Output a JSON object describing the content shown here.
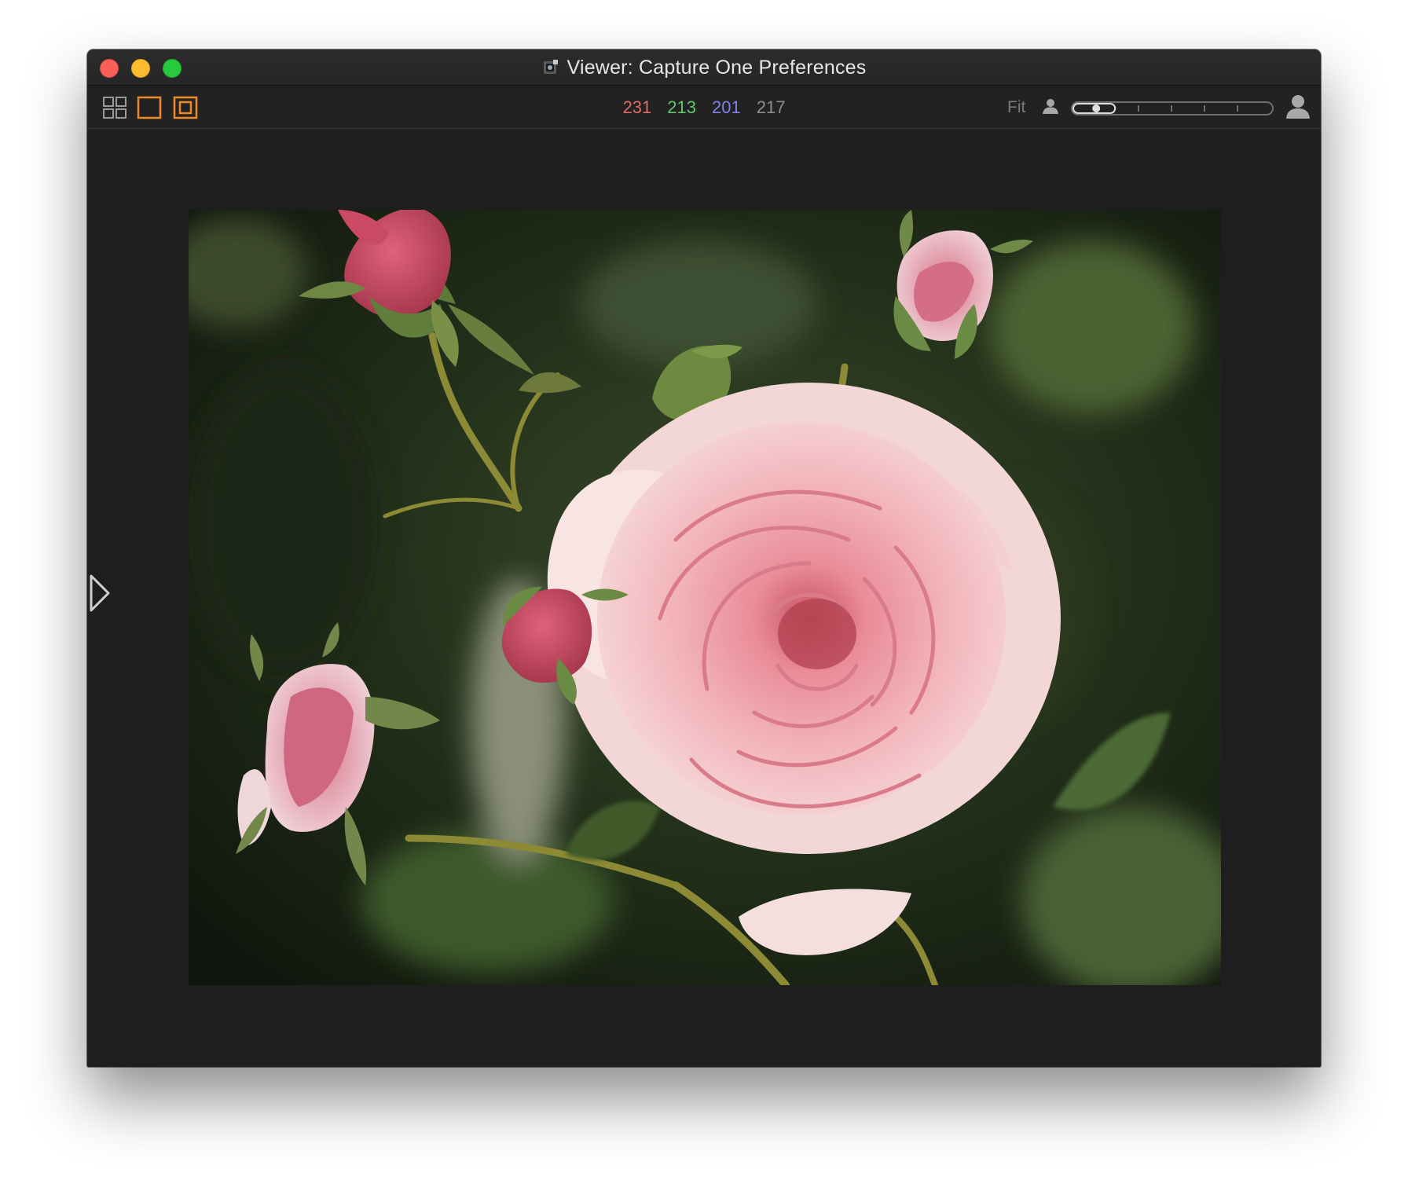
{
  "window": {
    "title": "Viewer: Capture One Preferences"
  },
  "toolbar": {
    "icons": [
      "grid-view-icon",
      "single-view-icon",
      "proof-margin-icon"
    ],
    "readout": {
      "r": "231",
      "g": "213",
      "b": "201",
      "l": "217"
    },
    "fit_label": "Fit",
    "zoom_level_fraction": 0.1
  },
  "colors": {
    "accent": "#f08a24",
    "red_value": "#e06a6a",
    "green_value": "#5ec76a",
    "blue_value": "#7c82e6",
    "neutral_value": "#8d8d8d",
    "window_bg": "#1e1e1e"
  },
  "viewer": {
    "image_subject": "pink rose with buds"
  }
}
